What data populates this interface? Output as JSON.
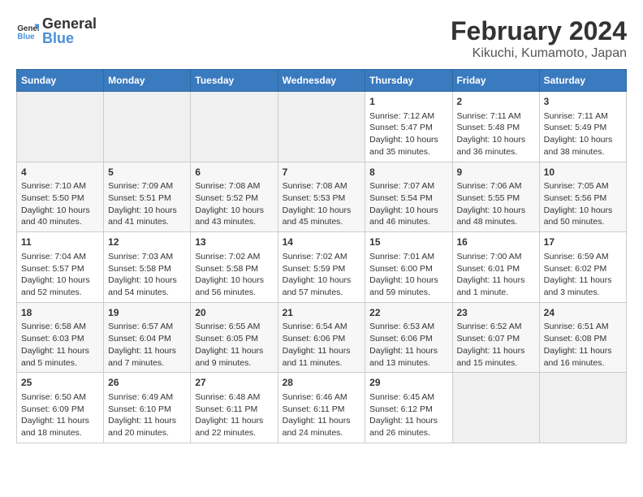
{
  "logo": {
    "text_general": "General",
    "text_blue": "Blue"
  },
  "title": "February 2024",
  "subtitle": "Kikuchi, Kumamoto, Japan",
  "days_of_week": [
    "Sunday",
    "Monday",
    "Tuesday",
    "Wednesday",
    "Thursday",
    "Friday",
    "Saturday"
  ],
  "weeks": [
    [
      {
        "day": "",
        "content": ""
      },
      {
        "day": "",
        "content": ""
      },
      {
        "day": "",
        "content": ""
      },
      {
        "day": "",
        "content": ""
      },
      {
        "day": "1",
        "content": "Sunrise: 7:12 AM\nSunset: 5:47 PM\nDaylight: 10 hours\nand 35 minutes."
      },
      {
        "day": "2",
        "content": "Sunrise: 7:11 AM\nSunset: 5:48 PM\nDaylight: 10 hours\nand 36 minutes."
      },
      {
        "day": "3",
        "content": "Sunrise: 7:11 AM\nSunset: 5:49 PM\nDaylight: 10 hours\nand 38 minutes."
      }
    ],
    [
      {
        "day": "4",
        "content": "Sunrise: 7:10 AM\nSunset: 5:50 PM\nDaylight: 10 hours\nand 40 minutes."
      },
      {
        "day": "5",
        "content": "Sunrise: 7:09 AM\nSunset: 5:51 PM\nDaylight: 10 hours\nand 41 minutes."
      },
      {
        "day": "6",
        "content": "Sunrise: 7:08 AM\nSunset: 5:52 PM\nDaylight: 10 hours\nand 43 minutes."
      },
      {
        "day": "7",
        "content": "Sunrise: 7:08 AM\nSunset: 5:53 PM\nDaylight: 10 hours\nand 45 minutes."
      },
      {
        "day": "8",
        "content": "Sunrise: 7:07 AM\nSunset: 5:54 PM\nDaylight: 10 hours\nand 46 minutes."
      },
      {
        "day": "9",
        "content": "Sunrise: 7:06 AM\nSunset: 5:55 PM\nDaylight: 10 hours\nand 48 minutes."
      },
      {
        "day": "10",
        "content": "Sunrise: 7:05 AM\nSunset: 5:56 PM\nDaylight: 10 hours\nand 50 minutes."
      }
    ],
    [
      {
        "day": "11",
        "content": "Sunrise: 7:04 AM\nSunset: 5:57 PM\nDaylight: 10 hours\nand 52 minutes."
      },
      {
        "day": "12",
        "content": "Sunrise: 7:03 AM\nSunset: 5:58 PM\nDaylight: 10 hours\nand 54 minutes."
      },
      {
        "day": "13",
        "content": "Sunrise: 7:02 AM\nSunset: 5:58 PM\nDaylight: 10 hours\nand 56 minutes."
      },
      {
        "day": "14",
        "content": "Sunrise: 7:02 AM\nSunset: 5:59 PM\nDaylight: 10 hours\nand 57 minutes."
      },
      {
        "day": "15",
        "content": "Sunrise: 7:01 AM\nSunset: 6:00 PM\nDaylight: 10 hours\nand 59 minutes."
      },
      {
        "day": "16",
        "content": "Sunrise: 7:00 AM\nSunset: 6:01 PM\nDaylight: 11 hours\nand 1 minute."
      },
      {
        "day": "17",
        "content": "Sunrise: 6:59 AM\nSunset: 6:02 PM\nDaylight: 11 hours\nand 3 minutes."
      }
    ],
    [
      {
        "day": "18",
        "content": "Sunrise: 6:58 AM\nSunset: 6:03 PM\nDaylight: 11 hours\nand 5 minutes."
      },
      {
        "day": "19",
        "content": "Sunrise: 6:57 AM\nSunset: 6:04 PM\nDaylight: 11 hours\nand 7 minutes."
      },
      {
        "day": "20",
        "content": "Sunrise: 6:55 AM\nSunset: 6:05 PM\nDaylight: 11 hours\nand 9 minutes."
      },
      {
        "day": "21",
        "content": "Sunrise: 6:54 AM\nSunset: 6:06 PM\nDaylight: 11 hours\nand 11 minutes."
      },
      {
        "day": "22",
        "content": "Sunrise: 6:53 AM\nSunset: 6:06 PM\nDaylight: 11 hours\nand 13 minutes."
      },
      {
        "day": "23",
        "content": "Sunrise: 6:52 AM\nSunset: 6:07 PM\nDaylight: 11 hours\nand 15 minutes."
      },
      {
        "day": "24",
        "content": "Sunrise: 6:51 AM\nSunset: 6:08 PM\nDaylight: 11 hours\nand 16 minutes."
      }
    ],
    [
      {
        "day": "25",
        "content": "Sunrise: 6:50 AM\nSunset: 6:09 PM\nDaylight: 11 hours\nand 18 minutes."
      },
      {
        "day": "26",
        "content": "Sunrise: 6:49 AM\nSunset: 6:10 PM\nDaylight: 11 hours\nand 20 minutes."
      },
      {
        "day": "27",
        "content": "Sunrise: 6:48 AM\nSunset: 6:11 PM\nDaylight: 11 hours\nand 22 minutes."
      },
      {
        "day": "28",
        "content": "Sunrise: 6:46 AM\nSunset: 6:11 PM\nDaylight: 11 hours\nand 24 minutes."
      },
      {
        "day": "29",
        "content": "Sunrise: 6:45 AM\nSunset: 6:12 PM\nDaylight: 11 hours\nand 26 minutes."
      },
      {
        "day": "",
        "content": ""
      },
      {
        "day": "",
        "content": ""
      }
    ]
  ]
}
